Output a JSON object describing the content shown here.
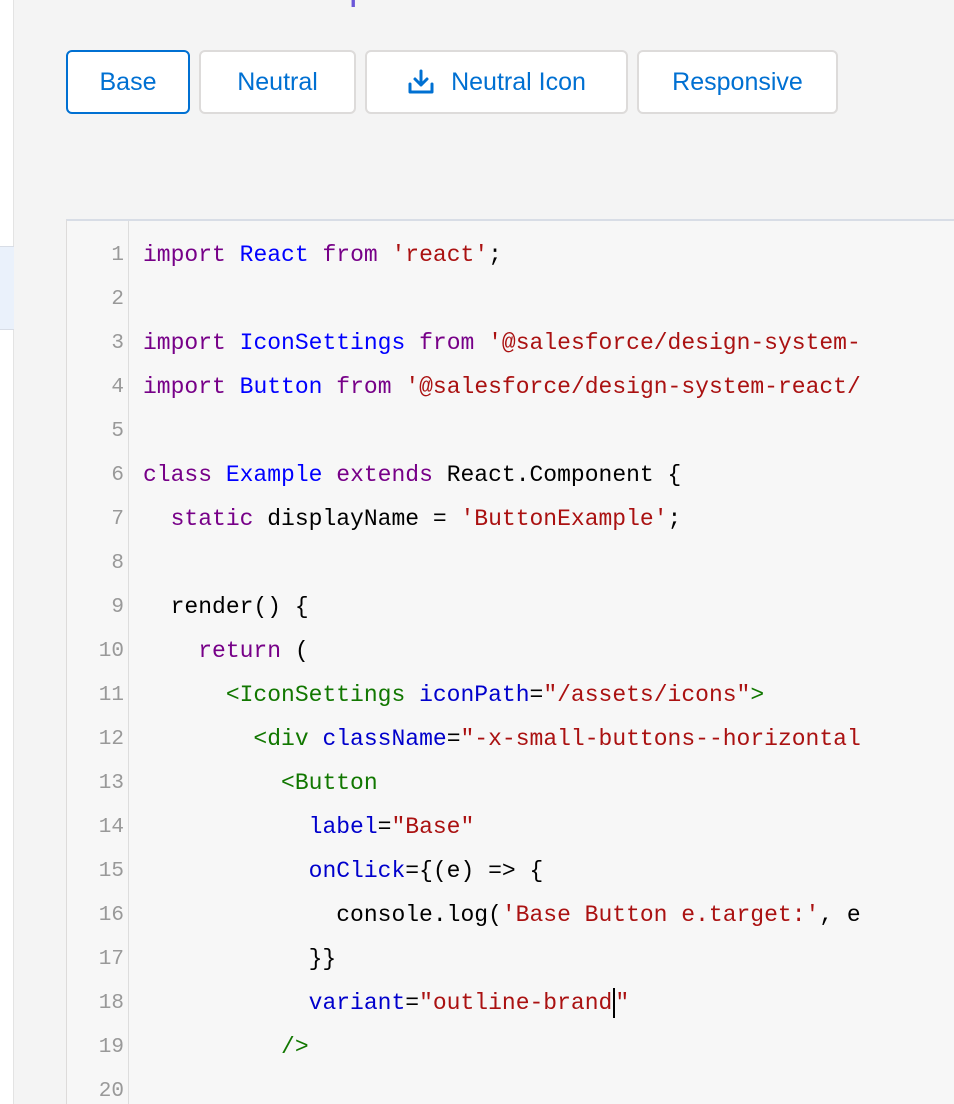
{
  "section_title": "Interactive Examples",
  "tabs": [
    {
      "label": "Base",
      "active": true,
      "icon": null
    },
    {
      "label": "Neutral",
      "active": false,
      "icon": null
    },
    {
      "label": "Neutral Icon",
      "active": false,
      "icon": "download-icon"
    },
    {
      "label": "Responsive",
      "active": false,
      "icon": null
    }
  ],
  "colors": {
    "brand": "#0070d2",
    "title": "#6b57d8",
    "keyword": "#770088",
    "definition": "#0000ff",
    "string": "#aa1111",
    "tag": "#117700",
    "attribute": "#0000cc"
  },
  "code_lines": [
    {
      "n": "1",
      "tokens": [
        [
          "kw",
          "import"
        ],
        [
          "plain",
          " "
        ],
        [
          "def",
          "React"
        ],
        [
          "plain",
          " "
        ],
        [
          "kw",
          "from"
        ],
        [
          "plain",
          " "
        ],
        [
          "str",
          "'react'"
        ],
        [
          "plain",
          ";"
        ]
      ]
    },
    {
      "n": "2",
      "tokens": []
    },
    {
      "n": "3",
      "tokens": [
        [
          "kw",
          "import"
        ],
        [
          "plain",
          " "
        ],
        [
          "def",
          "IconSettings"
        ],
        [
          "plain",
          " "
        ],
        [
          "kw",
          "from"
        ],
        [
          "plain",
          " "
        ],
        [
          "str",
          "'@salesforce/design-system-"
        ]
      ]
    },
    {
      "n": "4",
      "tokens": [
        [
          "kw",
          "import"
        ],
        [
          "plain",
          " "
        ],
        [
          "def",
          "Button"
        ],
        [
          "plain",
          " "
        ],
        [
          "kw",
          "from"
        ],
        [
          "plain",
          " "
        ],
        [
          "str",
          "'@salesforce/design-system-react/"
        ]
      ]
    },
    {
      "n": "5",
      "tokens": []
    },
    {
      "n": "6",
      "tokens": [
        [
          "kw",
          "class"
        ],
        [
          "plain",
          " "
        ],
        [
          "def",
          "Example"
        ],
        [
          "plain",
          " "
        ],
        [
          "kw",
          "extends"
        ],
        [
          "plain",
          " React.Component {"
        ]
      ]
    },
    {
      "n": "7",
      "tokens": [
        [
          "plain",
          "  "
        ],
        [
          "kw",
          "static"
        ],
        [
          "plain",
          " displayName = "
        ],
        [
          "str",
          "'ButtonExample'"
        ],
        [
          "plain",
          ";"
        ]
      ]
    },
    {
      "n": "8",
      "tokens": []
    },
    {
      "n": "9",
      "tokens": [
        [
          "plain",
          "  render() {"
        ]
      ]
    },
    {
      "n": "10",
      "tokens": [
        [
          "plain",
          "    "
        ],
        [
          "kw",
          "return"
        ],
        [
          "plain",
          " ("
        ]
      ]
    },
    {
      "n": "11",
      "tokens": [
        [
          "plain",
          "      "
        ],
        [
          "tag",
          "<IconSettings"
        ],
        [
          "plain",
          " "
        ],
        [
          "attr",
          "iconPath"
        ],
        [
          "plain",
          "="
        ],
        [
          "str",
          "\"/assets/icons\""
        ],
        [
          "tag",
          ">"
        ]
      ]
    },
    {
      "n": "12",
      "tokens": [
        [
          "plain",
          "        "
        ],
        [
          "tag",
          "<div"
        ],
        [
          "plain",
          " "
        ],
        [
          "attr",
          "className"
        ],
        [
          "plain",
          "="
        ],
        [
          "str",
          "\"-x-small-buttons--horizontal"
        ]
      ]
    },
    {
      "n": "13",
      "tokens": [
        [
          "plain",
          "          "
        ],
        [
          "tag",
          "<Button"
        ]
      ]
    },
    {
      "n": "14",
      "tokens": [
        [
          "plain",
          "            "
        ],
        [
          "attr",
          "label"
        ],
        [
          "plain",
          "="
        ],
        [
          "str",
          "\"Base\""
        ]
      ]
    },
    {
      "n": "15",
      "tokens": [
        [
          "plain",
          "            "
        ],
        [
          "attr",
          "onClick"
        ],
        [
          "plain",
          "={(e) => {"
        ]
      ]
    },
    {
      "n": "16",
      "tokens": [
        [
          "plain",
          "              console.log("
        ],
        [
          "str",
          "'Base Button e.target:'"
        ],
        [
          "plain",
          ", e"
        ]
      ]
    },
    {
      "n": "17",
      "tokens": [
        [
          "plain",
          "            }}"
        ]
      ]
    },
    {
      "n": "18",
      "tokens": [
        [
          "plain",
          "            "
        ],
        [
          "attr",
          "variant"
        ],
        [
          "plain",
          "="
        ],
        [
          "str",
          "\"outline-brand"
        ],
        [
          "cursor",
          ""
        ],
        [
          "str",
          "\""
        ]
      ]
    },
    {
      "n": "19",
      "tokens": [
        [
          "plain",
          "          "
        ],
        [
          "tag",
          "/>"
        ]
      ]
    },
    {
      "n": "20",
      "tokens": []
    }
  ]
}
